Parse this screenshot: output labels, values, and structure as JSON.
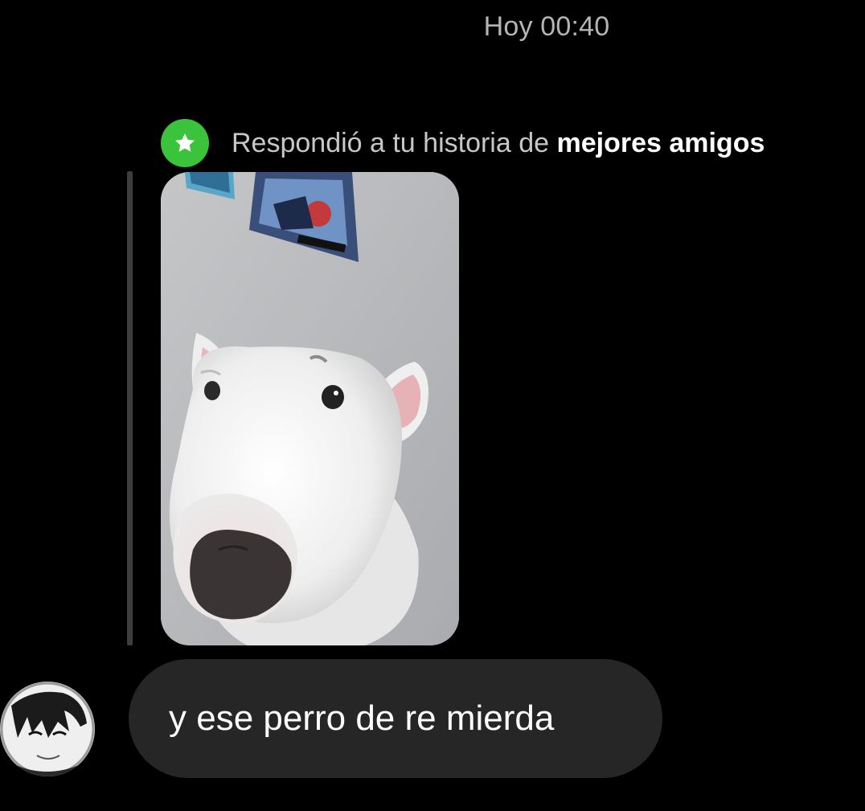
{
  "chat": {
    "timestamp": "Hoy 00:40",
    "story_reply": {
      "prefix": "Respondió a tu historia de ",
      "emphasis": "mejores amigos",
      "badge_icon": "star-icon",
      "badge_color": "#3bc43b"
    },
    "story_preview": {
      "subject": "bull terrier dog photo"
    },
    "message": {
      "text": "y ese perro de re mierda",
      "bubble_color": "#262626"
    },
    "sender": {
      "avatar_icon": "anime-avatar"
    }
  }
}
